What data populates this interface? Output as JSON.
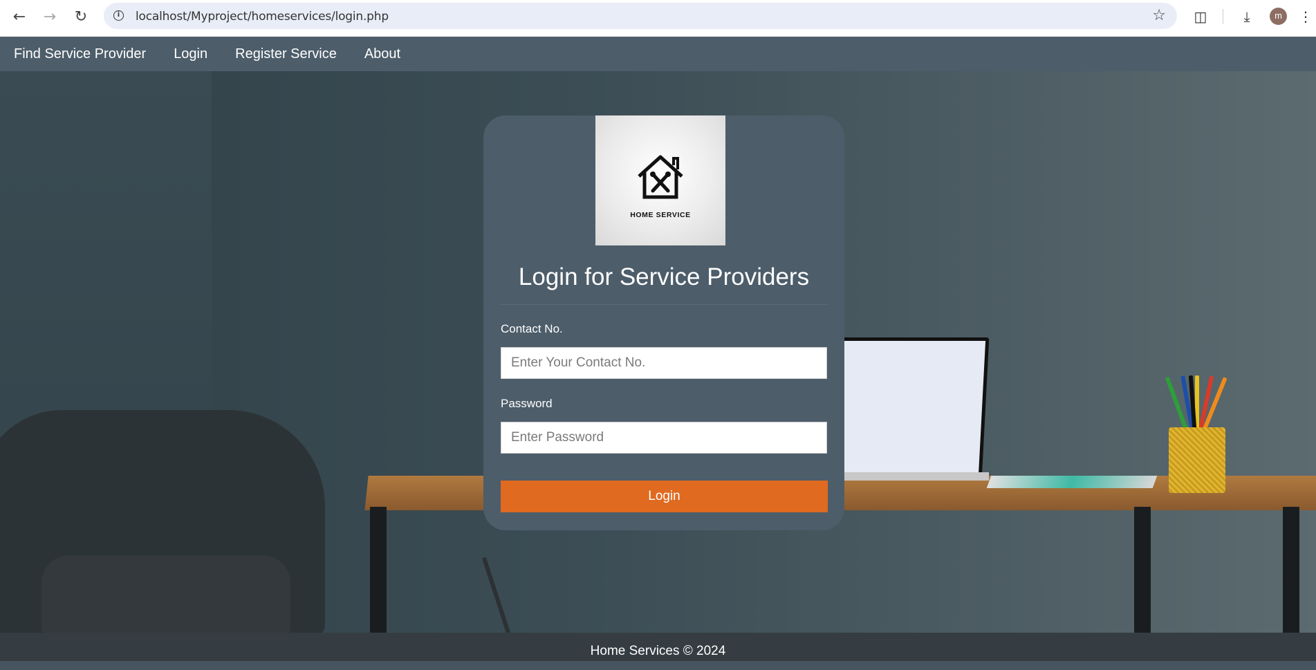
{
  "browser": {
    "url": "localhost/Myproject/homeservices/login.php",
    "avatar_letter": "m",
    "icons": [
      "back-arrow-icon",
      "forward-arrow-icon",
      "reload-icon",
      "site-info-icon",
      "bookmark-star-icon",
      "extensions-icon",
      "download-icon",
      "menu-dots-icon"
    ]
  },
  "nav": {
    "items": [
      {
        "label": "Find Service Provider"
      },
      {
        "label": "Login"
      },
      {
        "label": "Register Service"
      },
      {
        "label": "About"
      }
    ]
  },
  "login": {
    "logo_text": "HOME SERVICE",
    "title": "Login for Service Providers",
    "contact_label": "Contact No.",
    "contact_placeholder": "Enter Your Contact No.",
    "password_label": "Password",
    "password_placeholder": "Enter Password",
    "submit_label": "Login"
  },
  "footer": {
    "text": "Home Services © 2024"
  },
  "colors": {
    "nav_bg": "#4d5d6a",
    "card_bg": "#4d5d6a",
    "button": "#df6a20",
    "footer_bg": "#353d43"
  }
}
